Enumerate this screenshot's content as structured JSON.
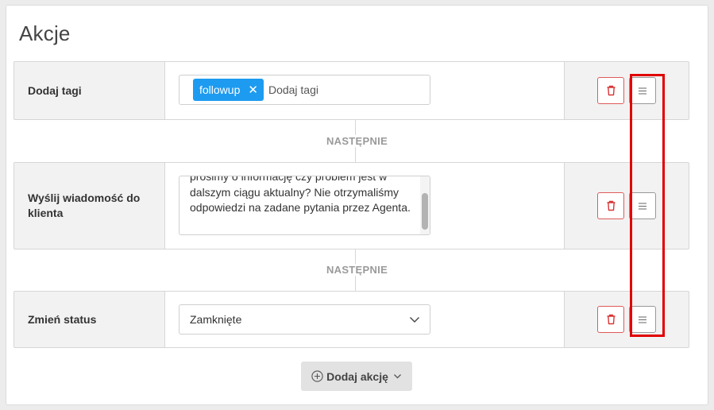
{
  "section": {
    "title": "Akcje"
  },
  "actions": [
    {
      "label": "Dodaj tagi",
      "tag": "followup",
      "tag_remove": "✕",
      "placeholder": "Dodaj tagi"
    },
    {
      "label": "Wyślij wiadomość do klienta",
      "message": "prosimy o informację czy problem jest w dalszym ciągu aktualny? Nie otrzymaliśmy odpowiedzi na zadane pytania przez Agenta."
    },
    {
      "label": "Zmień status",
      "selected": "Zamknięte"
    }
  ],
  "connectors": {
    "next_label": "NASTĘPNIE"
  },
  "footer": {
    "add_action_label": "Dodaj akcję"
  },
  "colors": {
    "tag_chip": "#1d9bf0",
    "delete_border": "#e05a5a",
    "highlight": "#e00000"
  },
  "icons": {
    "delete": "trash-icon",
    "drag": "drag-handle-icon",
    "select": "chevron-down-icon",
    "add": "plus-circle-icon",
    "dropdown": "chevron-down-icon"
  }
}
